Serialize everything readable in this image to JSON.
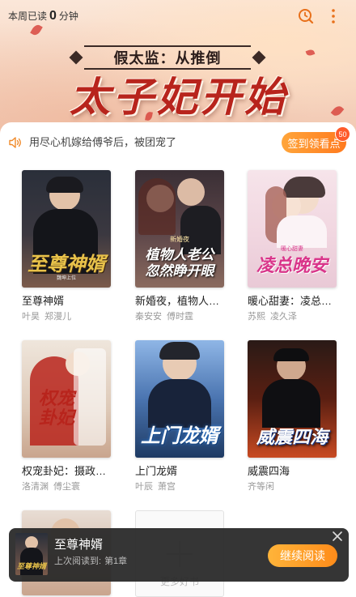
{
  "header": {
    "weekly_prefix": "本周已读",
    "weekly_minutes": "0",
    "weekly_suffix": "分钟",
    "search_icon": "search-clock-icon",
    "more_icon": "more-vertical-icon"
  },
  "banner": {
    "subtitle": "假太监：从推倒",
    "title": "太子妃开始"
  },
  "notice": {
    "icon": "speaker-icon",
    "text": "用尽心机嫁给傅爷后，被团宠了",
    "checkin_label": "签到领看点",
    "checkin_badge": "50"
  },
  "books": [
    {
      "title": "至尊神婿",
      "authors": [
        "叶昊",
        "郑漫儿"
      ],
      "cover_title": "至尊神婿",
      "cover_sub": "魏坤上位",
      "cover_colors": [
        "#2a2f3a",
        "#7a5a4a"
      ],
      "cover_title_color": "#e8c24a"
    },
    {
      "title": "新婚夜，植物人老公忽然睁开眼",
      "authors": [
        "秦安安",
        "傅时霆"
      ],
      "cover_title": "植物人老公",
      "cover_title2": "忽然睁开眼",
      "cover_sub": "新婚夜",
      "cover_colors": [
        "#3a2f35",
        "#8a6a5e"
      ],
      "cover_title_color": "#ffffff"
    },
    {
      "title": "暖心甜妻：凌总晚安",
      "authors": [
        "苏熙",
        "凌久泽"
      ],
      "cover_title": "凌总晚安",
      "cover_sub": "暖心甜妻",
      "cover_colors": [
        "#f6e4ea",
        "#e9c9d6"
      ],
      "cover_title_color": "#d9358a"
    },
    {
      "title": "权宠卦妃：摄政王的心尖宠",
      "authors": [
        "洛清渊",
        "傅尘寰"
      ],
      "cover_title": "权宠卦妃",
      "cover_sub": "",
      "cover_colors": [
        "#efe6dc",
        "#c9a58e"
      ],
      "cover_title_color": "#b8241c"
    },
    {
      "title": "上门龙婿",
      "authors": [
        "叶辰",
        "萧宫"
      ],
      "cover_title": "上门龙婿",
      "cover_sub": "",
      "cover_colors": [
        "#1e3a63",
        "#8fb6e6"
      ],
      "cover_title_color": "#ffffff"
    },
    {
      "title": "威震四海",
      "authors": [
        "齐等闲"
      ],
      "cover_title": "威震四海",
      "cover_sub": "",
      "cover_colors": [
        "#5a1f12",
        "#c84a22"
      ],
      "cover_title_color": "#ffffff"
    }
  ],
  "add_book": {
    "label": "更多好书"
  },
  "continue_popup": {
    "title": "至尊神婿",
    "last_read_label": "上次阅读到:",
    "last_read_chapter": "第1章",
    "button": "继续阅读",
    "cover_title": "至尊神婿",
    "close_icon": "close-icon"
  },
  "colors": {
    "accent": "#ff8c1a",
    "banner_title": "#b8241c"
  }
}
